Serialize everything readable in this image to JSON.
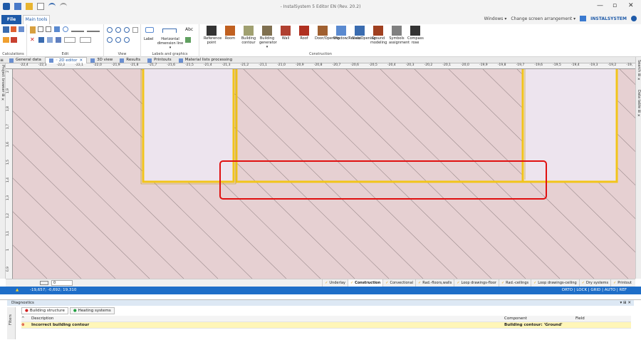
{
  "window": {
    "title": "- InstalSystem 5 Editor EN (Rev. 20.2)",
    "controls": [
      "—",
      "▫",
      "✕"
    ]
  },
  "ribbon_tabs": {
    "file": "File",
    "main": "Main tools"
  },
  "top_right": {
    "windows": "Windows ▾",
    "arrangement": "Change screen arrangement ▾",
    "brand": "INSTALSYSTEM"
  },
  "ribbon_groups": {
    "calculations": "Calculations",
    "edit": "Edit",
    "view": "View",
    "labels": "Labels and graphics",
    "construction": "Construction"
  },
  "labels_buttons": {
    "label": "Label",
    "horizontal": "Horizontal dimension line ▾"
  },
  "construction_buttons": [
    {
      "label": "Reference point",
      "icon": "reference-point-icon"
    },
    {
      "label": "Room",
      "icon": "room-icon"
    },
    {
      "label": "Building contour",
      "icon": "building-contour-icon"
    },
    {
      "label": "Building generator ▾",
      "icon": "building-generator-icon"
    },
    {
      "label": "Wall",
      "icon": "wall-icon"
    },
    {
      "label": "Roof",
      "icon": "roof-icon"
    },
    {
      "label": "Door/Opening",
      "icon": "door-icon"
    },
    {
      "label": "Window/Recess",
      "icon": "window-icon"
    },
    {
      "label": "Slab/Opening",
      "icon": "slab-icon"
    },
    {
      "label": "Ground modeling",
      "icon": "ground-icon"
    },
    {
      "label": "Symbols assignment",
      "icon": "symbols-icon"
    },
    {
      "label": "Compass rose",
      "icon": "compass-icon"
    }
  ],
  "doc_tabs": [
    {
      "label": "General data",
      "icon": "general-data-icon",
      "active": false
    },
    {
      "label": "◦ 2D editor",
      "icon": "2d-editor-icon",
      "active": true
    },
    {
      "label": "3D view",
      "icon": "3d-view-icon",
      "active": false
    },
    {
      "label": "Results",
      "icon": "results-icon",
      "active": false
    },
    {
      "label": "Printouts",
      "icon": "printouts-icon",
      "active": false
    },
    {
      "label": "Material lists processing",
      "icon": "material-icon",
      "active": false
    }
  ],
  "side_panels": {
    "left": "Project browser ⊞ ✕",
    "right1": "Search ⊞ ✕",
    "right2": "Data table ⊞ ✕"
  },
  "ruler_h": [
    "-22,4",
    "-22,3",
    "-22,2",
    "-22,1",
    "-22,0",
    "-21,9",
    "-21,8",
    "-21,7",
    "-21,6",
    "-21,5",
    "-21,4",
    "-21,3",
    "-21,2",
    "-21,1",
    "-21,0",
    "-20,9",
    "-20,8",
    "-20,7",
    "-20,6",
    "-20,5",
    "-20,4",
    "-20,3",
    "-20,2",
    "-20,1",
    "-20,0",
    "-19,9",
    "-19,8",
    "-19,7",
    "-19,6",
    "-19,5",
    "-19,4",
    "-19,3",
    "-19,2",
    "-19,"
  ],
  "ruler_v": [
    "2",
    "1,9",
    "1,8",
    "1,7",
    "1,6",
    "1,5",
    "1,4",
    "1,3",
    "1,2",
    "1,1",
    "1",
    "0,9"
  ],
  "status": {
    "level": "0"
  },
  "layers": [
    {
      "label": "Underlay",
      "active": false
    },
    {
      "label": "Construction",
      "active": true
    },
    {
      "label": "Convectional",
      "active": false
    },
    {
      "label": "Rad.-floors,walls",
      "active": false
    },
    {
      "label": "Loop drawings-floor",
      "active": false
    },
    {
      "label": "Rad.-ceilings",
      "active": false
    },
    {
      "label": "Loop drawings-ceiling",
      "active": false
    },
    {
      "label": "Dry systems",
      "active": false
    },
    {
      "label": "Printout",
      "active": false
    }
  ],
  "coords": {
    "text": "-19,657; -0,692; 19,310",
    "modes": "ORTO | LOCK | GRID | AUTO | REF"
  },
  "diagnostics": {
    "title": "Diagnostics",
    "filters": "Filters",
    "tabs": [
      "Building structure",
      "Heating systems"
    ],
    "headers": {
      "description": "Description",
      "component": "Component",
      "field": "Field"
    },
    "rows": [
      {
        "description": "Incorrect building contour",
        "component": "Building contour: 'Ground'",
        "field": ""
      }
    ]
  },
  "colors": {
    "accent": "#1e5aa8",
    "canvas": "#e6d0d2",
    "wall": "#f0c020",
    "room": "#ede4ee",
    "highlight": "#e01010",
    "statusbar": "#1e6ec8"
  }
}
